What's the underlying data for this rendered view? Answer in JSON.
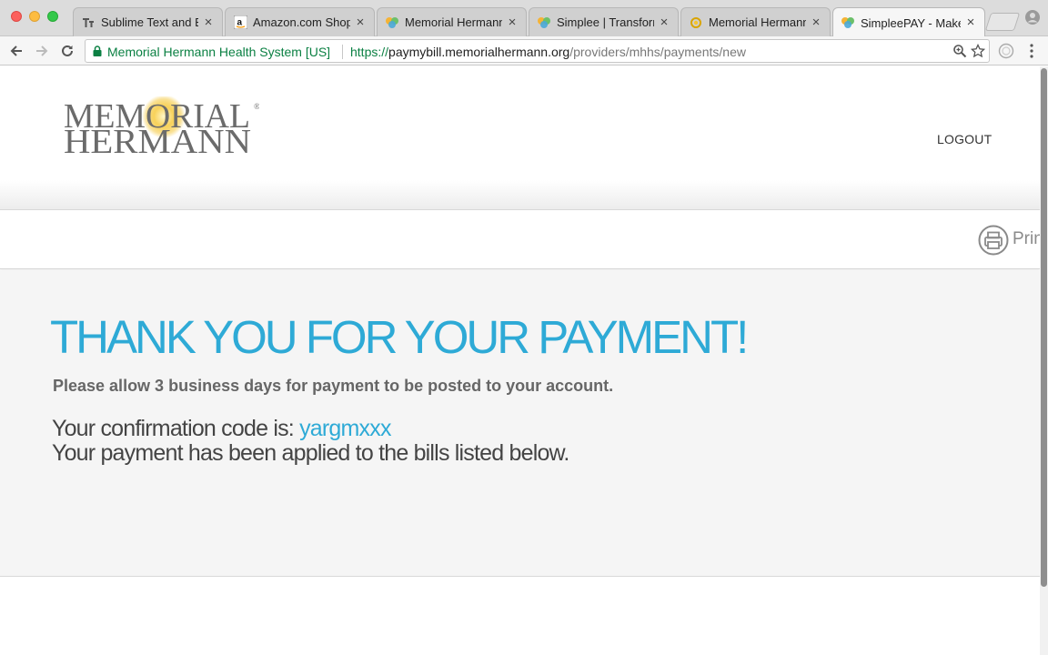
{
  "browser": {
    "tabs": [
      {
        "title": "Sublime Text and Ba",
        "icon": "sublime-favicon"
      },
      {
        "title": "Amazon.com Shopp",
        "icon": "amazon-favicon"
      },
      {
        "title": "Memorial Hermann",
        "icon": "simplee-favicon"
      },
      {
        "title": "Simplee | Transform",
        "icon": "simplee-favicon"
      },
      {
        "title": "Memorial Hermann",
        "icon": "memorial-hermann-favicon"
      },
      {
        "title": "SimpleePAY - Make",
        "icon": "simplee-favicon",
        "active": true
      }
    ],
    "security_label": "Memorial Hermann Health System [US]",
    "url_scheme": "https://",
    "url_host": "paymybill.memorialhermann.org",
    "url_path": "/providers/mhhs/payments/new",
    "colors": {
      "secure_green": "#0b8043"
    }
  },
  "header": {
    "logo_line1": "MEMORIAL",
    "logo_line2": "HERMANN",
    "logout_label": "LOGOUT"
  },
  "print": {
    "label": "Print"
  },
  "main": {
    "heading": "THANK YOU FOR YOUR PAYMENT!",
    "subtext": "Please allow 3 business days for payment to be posted to your account.",
    "confirmation_prefix": "Your confirmation code is:",
    "confirmation_code": "yargmxxx",
    "applied_text": "Your payment has been applied to the bills listed below.",
    "colors": {
      "accent": "#2eaad6",
      "panel_bg": "#f5f5f5"
    }
  }
}
